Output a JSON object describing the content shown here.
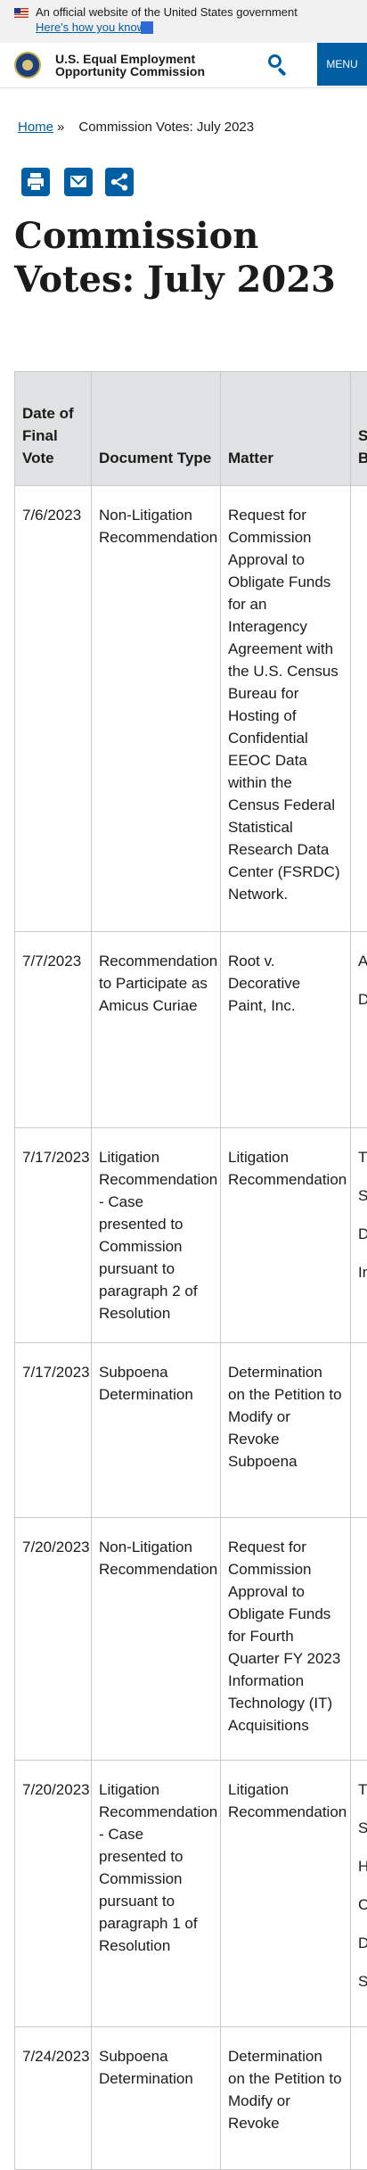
{
  "gov_banner": {
    "official_text": "An official website of the United States government",
    "link_text": "Here's how you know"
  },
  "header": {
    "agency_line1": "U.S. Equal Employment",
    "agency_line2": "Opportunity Commission",
    "menu_label": "MENU"
  },
  "breadcrumb": {
    "home": "Home",
    "separator": "»",
    "current": "Commission Votes: July 2023"
  },
  "page": {
    "title": "Commission Votes: July 2023"
  },
  "table": {
    "headers": [
      "Date of Final Vote",
      "Document Type",
      "Matter",
      "Statutory Issue(s) Basis(es) Involved"
    ],
    "rows": [
      {
        "date": "7/6/2023",
        "doc_type": "Non-Litigation Recommendation",
        "matter": "Request for Commission Approval to Obligate Funds for an Interagency Agreement with the U.S. Census Bureau for Hosting of Confidential EEOC Data within the Census Federal Statistical Research Data Center (FSRDC) Network.",
        "issues": []
      },
      {
        "date": "7/7/2023",
        "doc_type": "Recommendation to Participate as Amicus Curiae",
        "matter": "Root v. Decorative Paint, Inc.",
        "issues": [
          "A",
          "D"
        ]
      },
      {
        "date": "7/17/2023",
        "doc_type": "Litigation Recommendation - Case presented to Commission pursuant to paragraph 2 of Resolution",
        "matter": "Litigation Recommendation",
        "issues": [
          "T",
          "S",
          "D",
          "In"
        ]
      },
      {
        "date": "7/17/2023",
        "doc_type": "Subpoena Determination",
        "matter": "Determination on the Petition to Modify or Revoke Subpoena",
        "issues": []
      },
      {
        "date": "7/20/2023",
        "doc_type": "Non-Litigation Recommendation",
        "matter": "Request for Commission Approval to Obligate Funds for Fourth Quarter FY 2023 Information Technology (IT) Acquisitions",
        "issues": []
      },
      {
        "date": "7/20/2023",
        "doc_type": "Litigation Recommendation - Case presented to Commission pursuant to paragraph 1 of Resolution",
        "matter": "Litigation Recommendation",
        "issues": [
          "T",
          "S",
          "H",
          "C",
          "D",
          "S"
        ]
      },
      {
        "date": "7/24/2023",
        "doc_type": "Subpoena Determination",
        "matter": "Determination on the Petition to Modify or Revoke",
        "issues": []
      }
    ]
  },
  "colors": {
    "primary": "#005ea2",
    "banner_bg": "#f0f0f0",
    "table_header_bg": "#dfe1e2"
  },
  "icons": [
    "us-flag-icon",
    "agency-seal-icon",
    "search-icon",
    "print-icon",
    "email-icon",
    "share-icon"
  ]
}
